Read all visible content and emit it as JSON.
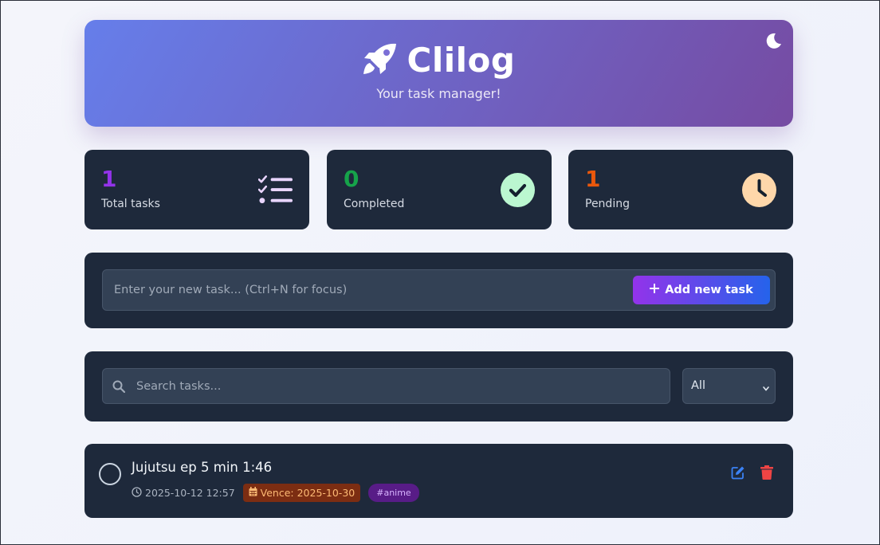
{
  "header": {
    "title": "Clilog",
    "subtitle": "Your task manager!",
    "icon": "rocket-icon",
    "theme_toggle_icon": "moon-icon"
  },
  "stats": [
    {
      "value": "1",
      "label": "Total tasks",
      "color": "#9333ea",
      "icon": "list-check-icon",
      "icon_bg": "transparent"
    },
    {
      "value": "0",
      "label": "Completed",
      "color": "#16a34a",
      "icon": "check-circle-icon",
      "icon_bg": "#bbf7d0"
    },
    {
      "value": "1",
      "label": "Pending",
      "color": "#ea580c",
      "icon": "clock-icon",
      "icon_bg": "#fed7aa"
    }
  ],
  "add_task": {
    "placeholder": "Enter your new task... (Ctrl+N for focus)",
    "value": "",
    "button_label": "Add new task",
    "button_icon": "plus-icon"
  },
  "search": {
    "placeholder": "Search tasks...",
    "value": "",
    "icon": "search-icon"
  },
  "filter": {
    "selected": "All"
  },
  "tasks": [
    {
      "title": "Jujutsu ep 5 min 1:46",
      "created": "2025-10-12 12:57",
      "due": "Vence: 2025-10-30",
      "tag": "#anime",
      "completed": false
    }
  ],
  "colors": {
    "accent_gradient_start": "#667eea",
    "accent_gradient_end": "#764ba2",
    "panel_bg": "#1e293b",
    "edit": "#3b82f6",
    "delete": "#ef4444"
  }
}
